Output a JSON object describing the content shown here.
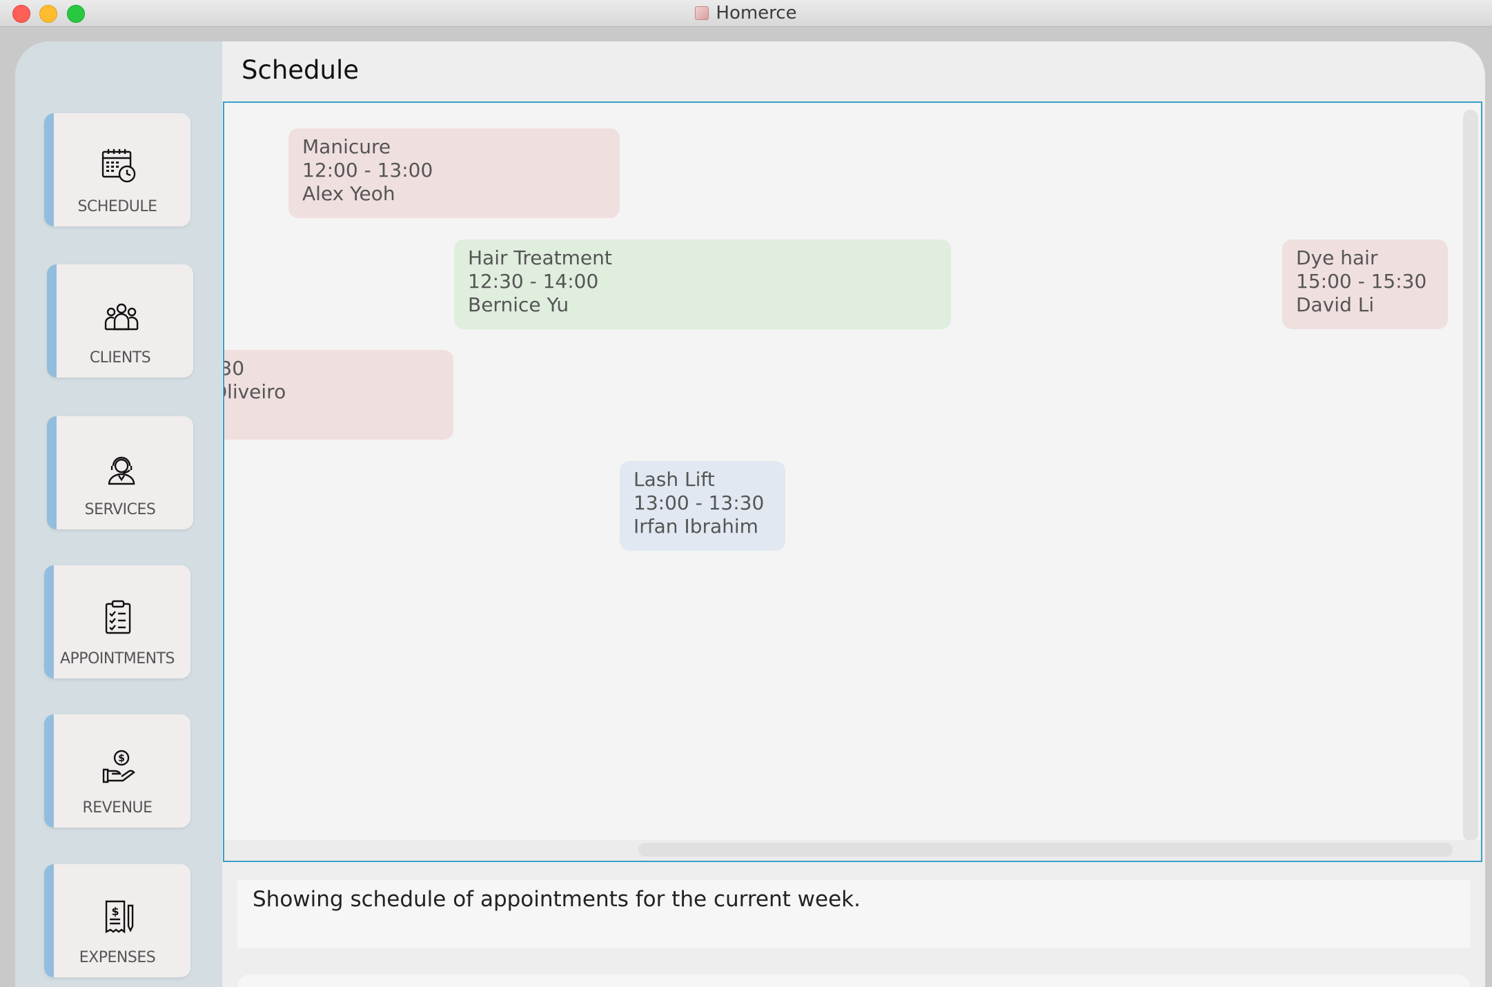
{
  "window": {
    "title": "Homerce"
  },
  "sidebar": {
    "items": [
      {
        "label": "SCHEDULE",
        "icon": "calendar-clock-icon"
      },
      {
        "label": "CLIENTS",
        "icon": "people-group-icon"
      },
      {
        "label": "SERVICES",
        "icon": "hairdresser-icon"
      },
      {
        "label": "APPOINTMENTS",
        "icon": "clipboard-checklist-icon"
      },
      {
        "label": "REVENUE",
        "icon": "hand-coin-icon"
      },
      {
        "label": "EXPENSES",
        "icon": "receipt-pen-icon"
      }
    ]
  },
  "page": {
    "title": "Schedule"
  },
  "appointments": [
    {
      "service": "Manicure",
      "time": "12:00 - 13:00",
      "client": "Alex Yeoh",
      "color": "#f0dfdf"
    },
    {
      "service": "Hair Treatment",
      "time": "12:30 - 14:00",
      "client": "Bernice Yu",
      "color": "#dfeedd"
    },
    {
      "service": "Dye hair",
      "time": "15:00 - 15:30",
      "client": "David Li",
      "color": "#f0dfdf"
    },
    {
      "service": "",
      "time": ":30",
      "client": "Oliveiro",
      "color": "#f0dfdf"
    },
    {
      "service": "Lash Lift",
      "time": "13:00 - 13:30",
      "client": "Irfan Ibrahim",
      "color": "#e1e8f1"
    }
  ],
  "result": {
    "message": "Showing schedule of appointments for the current week."
  },
  "colors": {
    "accent": "#92bddd",
    "panel_border": "#3aa0c8",
    "sidebar_bg": "#d3dde2"
  }
}
